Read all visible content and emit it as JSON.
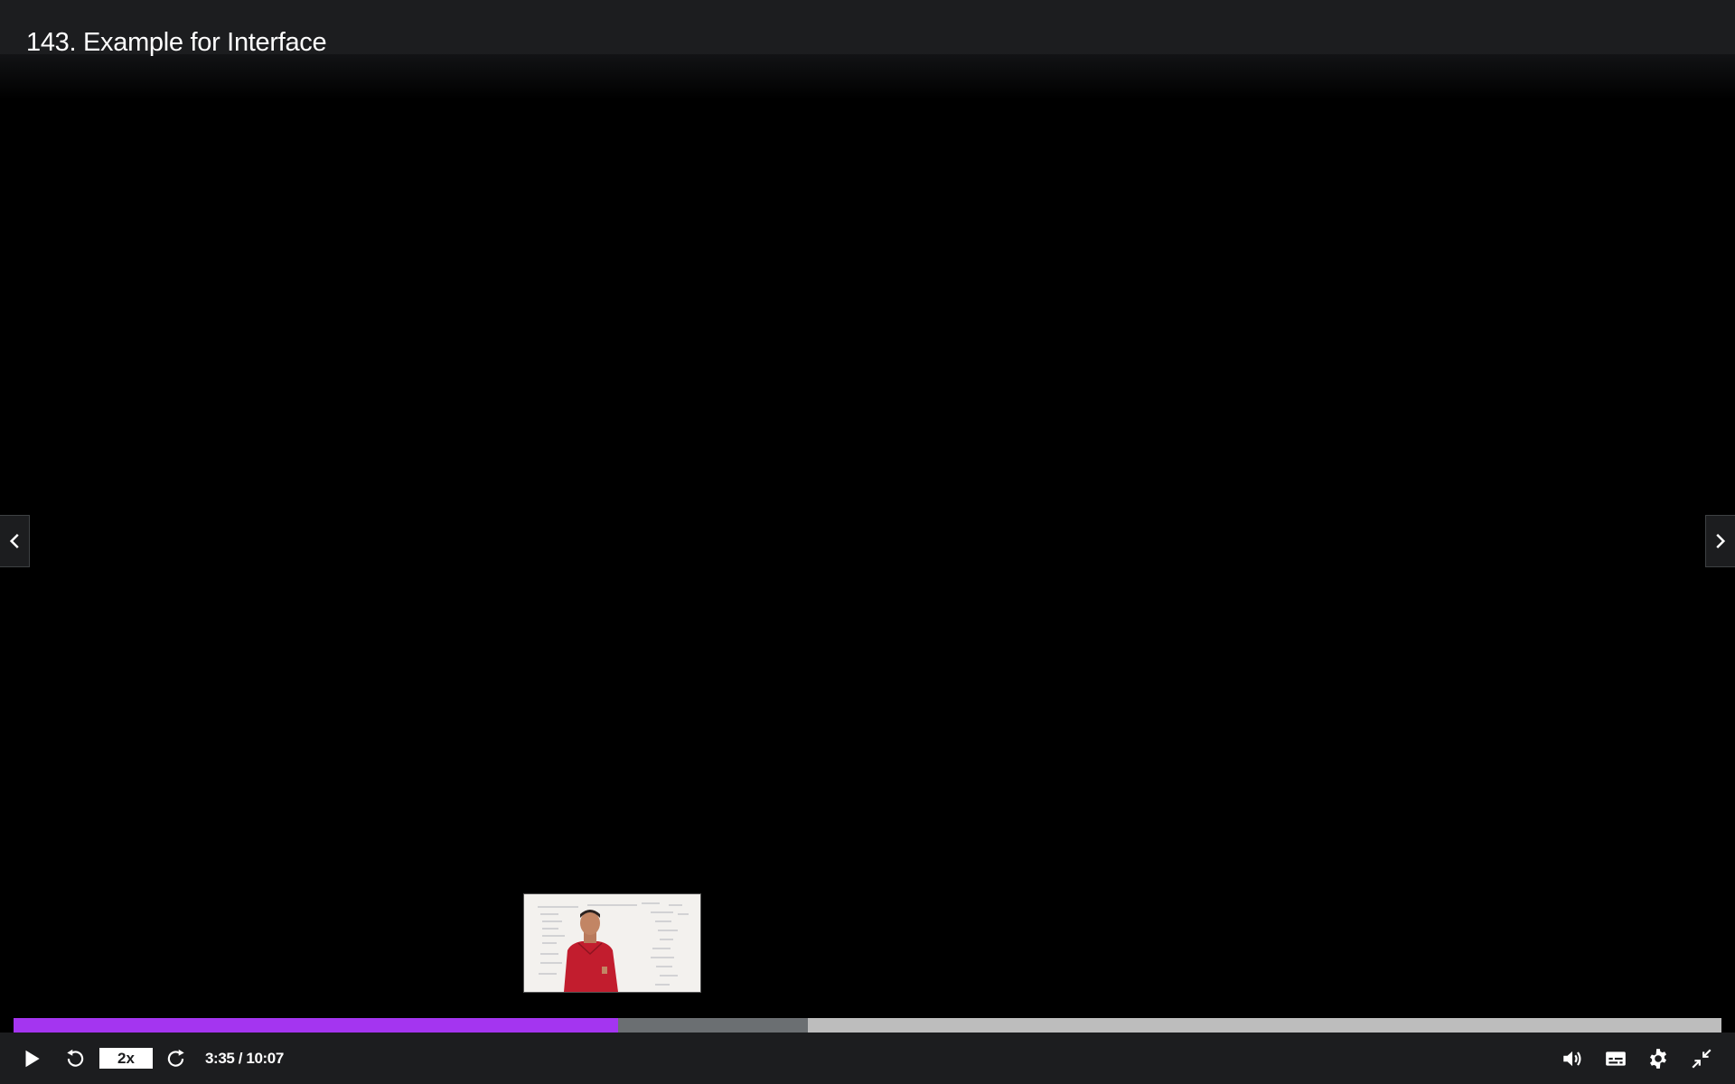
{
  "header": {
    "title": "143. Example for Interface"
  },
  "navigation": {
    "previous_icon": "chevron-left-icon",
    "next_icon": "chevron-right-icon"
  },
  "preview": {
    "description_icon": "preview-thumbnail"
  },
  "progress": {
    "played_fraction": 0.354,
    "buffered_fraction": 0.465,
    "played_color": "#a435f0",
    "buffered_color": "#6b6f72",
    "track_color": "#bdbdbd"
  },
  "controls": {
    "play_icon": "play-icon",
    "rewind_icon": "rewind-icon",
    "speed_label": "2x",
    "forward_icon": "forward-icon",
    "time_display": "3:35 / 10:07",
    "volume_icon": "volume-icon",
    "captions_icon": "captions-icon",
    "settings_icon": "gear-icon",
    "fullscreen_icon": "exit-fullscreen-icon"
  },
  "colors": {
    "bar_background": "#1c1d1f",
    "accent": "#a435f0",
    "text": "#ffffff"
  }
}
